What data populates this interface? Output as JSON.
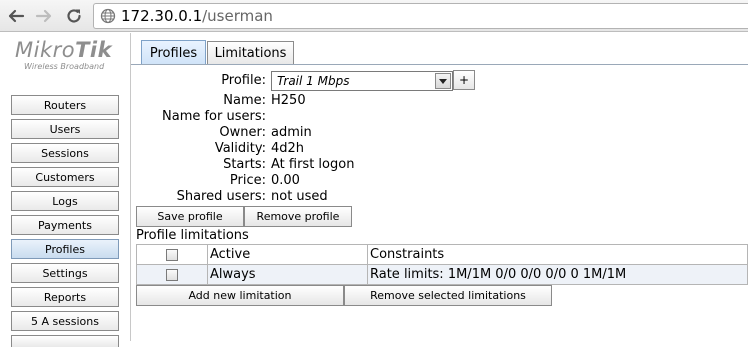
{
  "browser": {
    "url_host": "172.30.0.1",
    "url_path": "/userman"
  },
  "logo": {
    "brand_light": "Mikro",
    "brand_bold": "Tik",
    "tagline": "Wireless Broadband"
  },
  "sidebar": {
    "items": [
      {
        "label": "Routers"
      },
      {
        "label": "Users"
      },
      {
        "label": "Sessions"
      },
      {
        "label": "Customers"
      },
      {
        "label": "Logs"
      },
      {
        "label": "Payments"
      },
      {
        "label": "Profiles",
        "active": true
      },
      {
        "label": "Settings"
      },
      {
        "label": "Reports"
      },
      {
        "label": "5 A sessions"
      }
    ]
  },
  "tabs": [
    {
      "label": "Profiles",
      "active": true
    },
    {
      "label": "Limitations"
    }
  ],
  "form": {
    "profile_label": "Profile:",
    "profile_value": "Trail 1 Mbps",
    "add_button": "+",
    "fields": [
      {
        "label": "Name:",
        "value": "H250"
      },
      {
        "label": "Name for users:",
        "value": ""
      },
      {
        "label": "Owner:",
        "value": "admin"
      },
      {
        "label": "Validity:",
        "value": "4d2h"
      },
      {
        "label": "Starts:",
        "value": "At first logon"
      },
      {
        "label": "Price:",
        "value": "0.00"
      },
      {
        "label": "Shared users:",
        "value": "not used"
      }
    ],
    "save_button": "Save profile",
    "remove_button": "Remove profile"
  },
  "limitations": {
    "title": "Profile limitations",
    "columns": [
      "Active",
      "Constraints"
    ],
    "rows": [
      {
        "active": "Always",
        "constraints": "Rate limits: 1M/1M 0/0 0/0 0/0 0 1M/1M"
      }
    ],
    "add_button": "Add new limitation",
    "remove_button": "Remove selected limitations"
  },
  "colors": {
    "active_tab": "#cfe3f8",
    "row_highlight": "#eef2f8",
    "logo_gray": "#8e8e8e"
  }
}
